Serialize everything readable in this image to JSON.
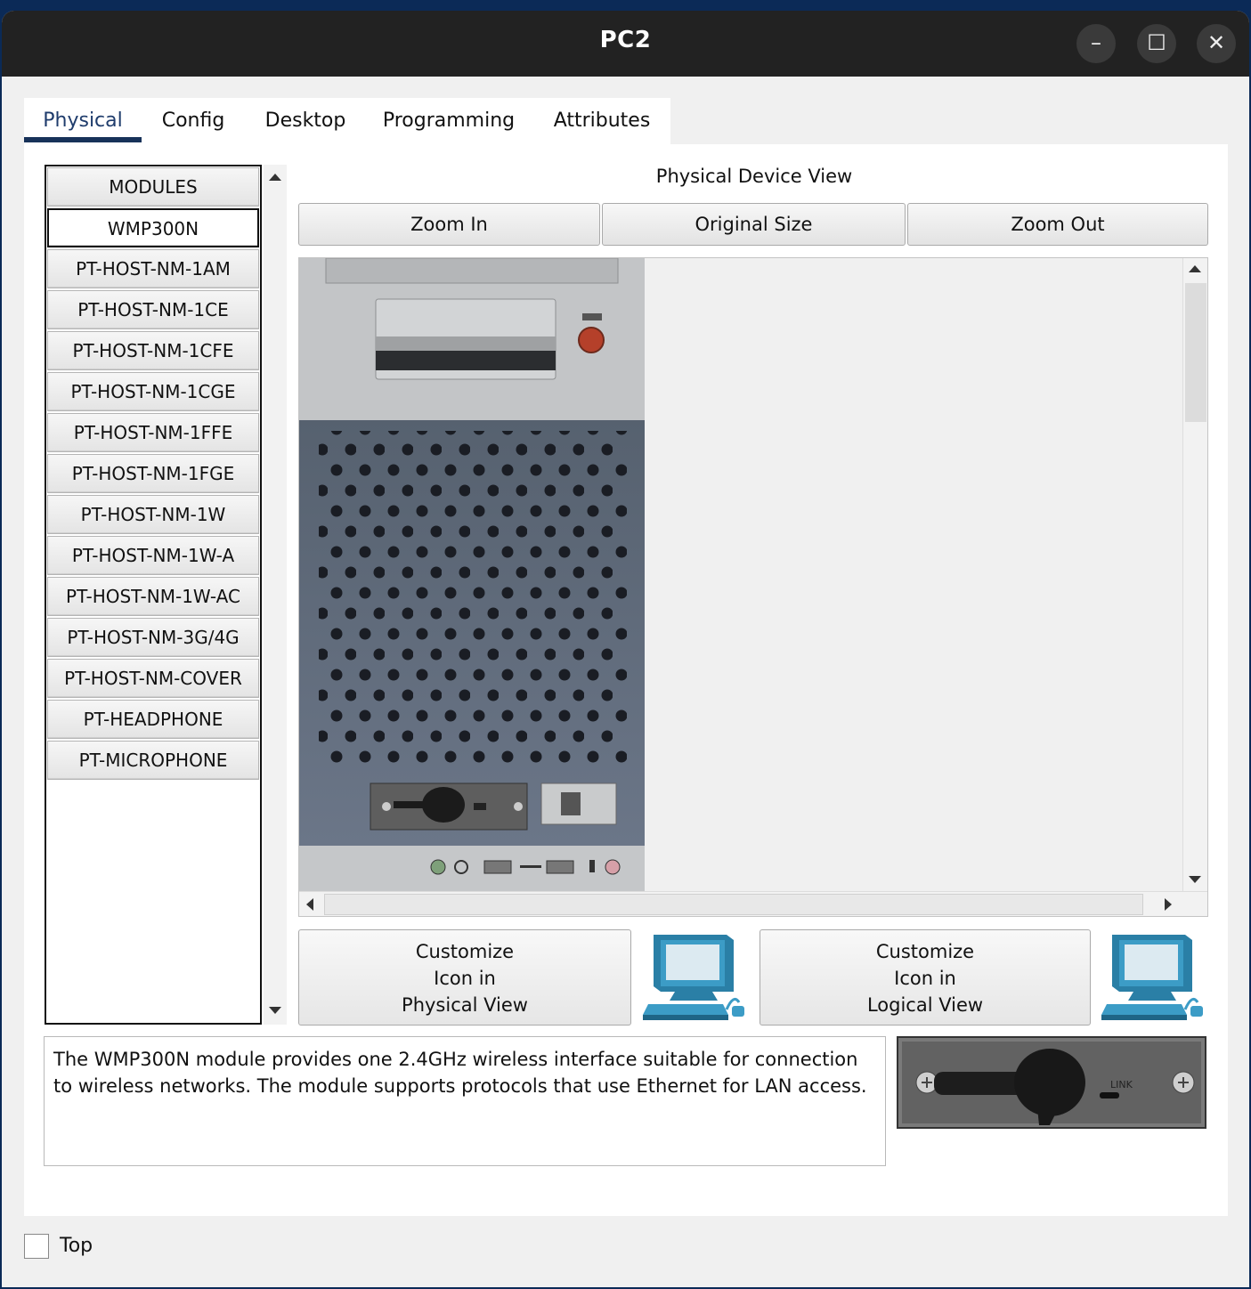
{
  "window": {
    "title": "PC2"
  },
  "tabs": [
    "Physical",
    "Config",
    "Desktop",
    "Programming",
    "Attributes"
  ],
  "modules": {
    "header": "MODULES",
    "items": [
      "WMP300N",
      "PT-HOST-NM-1AM",
      "PT-HOST-NM-1CE",
      "PT-HOST-NM-1CFE",
      "PT-HOST-NM-1CGE",
      "PT-HOST-NM-1FFE",
      "PT-HOST-NM-1FGE",
      "PT-HOST-NM-1W",
      "PT-HOST-NM-1W-A",
      "PT-HOST-NM-1W-AC",
      "PT-HOST-NM-3G/4G",
      "PT-HOST-NM-COVER",
      "PT-HEADPHONE",
      "PT-MICROPHONE"
    ],
    "selected": "WMP300N"
  },
  "physical_view": {
    "title": "Physical Device View",
    "zoom_in": "Zoom In",
    "original_size": "Original Size",
    "zoom_out": "Zoom Out"
  },
  "customize": {
    "physical": [
      "Customize",
      "Icon in",
      "Physical View"
    ],
    "logical": [
      "Customize",
      "Icon in",
      "Logical View"
    ]
  },
  "description": "The WMP300N module provides one 2.4GHz wireless interface suitable for connection to wireless networks. The module supports protocols that use Ethernet for LAN access.",
  "module_image": {
    "link_label": "LINK"
  },
  "footer": {
    "top_label": "Top",
    "top_checked": false
  }
}
